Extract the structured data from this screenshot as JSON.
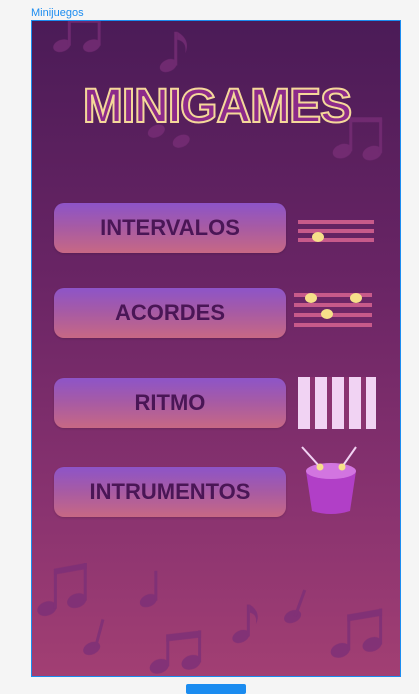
{
  "frame": {
    "label": "Minijuegos"
  },
  "title": "MINIGAMES",
  "buttons": [
    {
      "label": "INTERVALOS",
      "icon": "staff-interval-icon"
    },
    {
      "label": "ACORDES",
      "icon": "staff-chord-icon"
    },
    {
      "label": "RITMO",
      "icon": "piano-keys-icon"
    },
    {
      "label": "INTRUMENTOS",
      "icon": "drum-icon"
    }
  ],
  "colors": {
    "accent": "#1b8cf0",
    "title_fill": "#8c2a8a",
    "title_stroke": "#f5d89a",
    "button_text": "#4a1656",
    "note_dot": "#f6e08a",
    "staff_line": "#c75a8a"
  }
}
